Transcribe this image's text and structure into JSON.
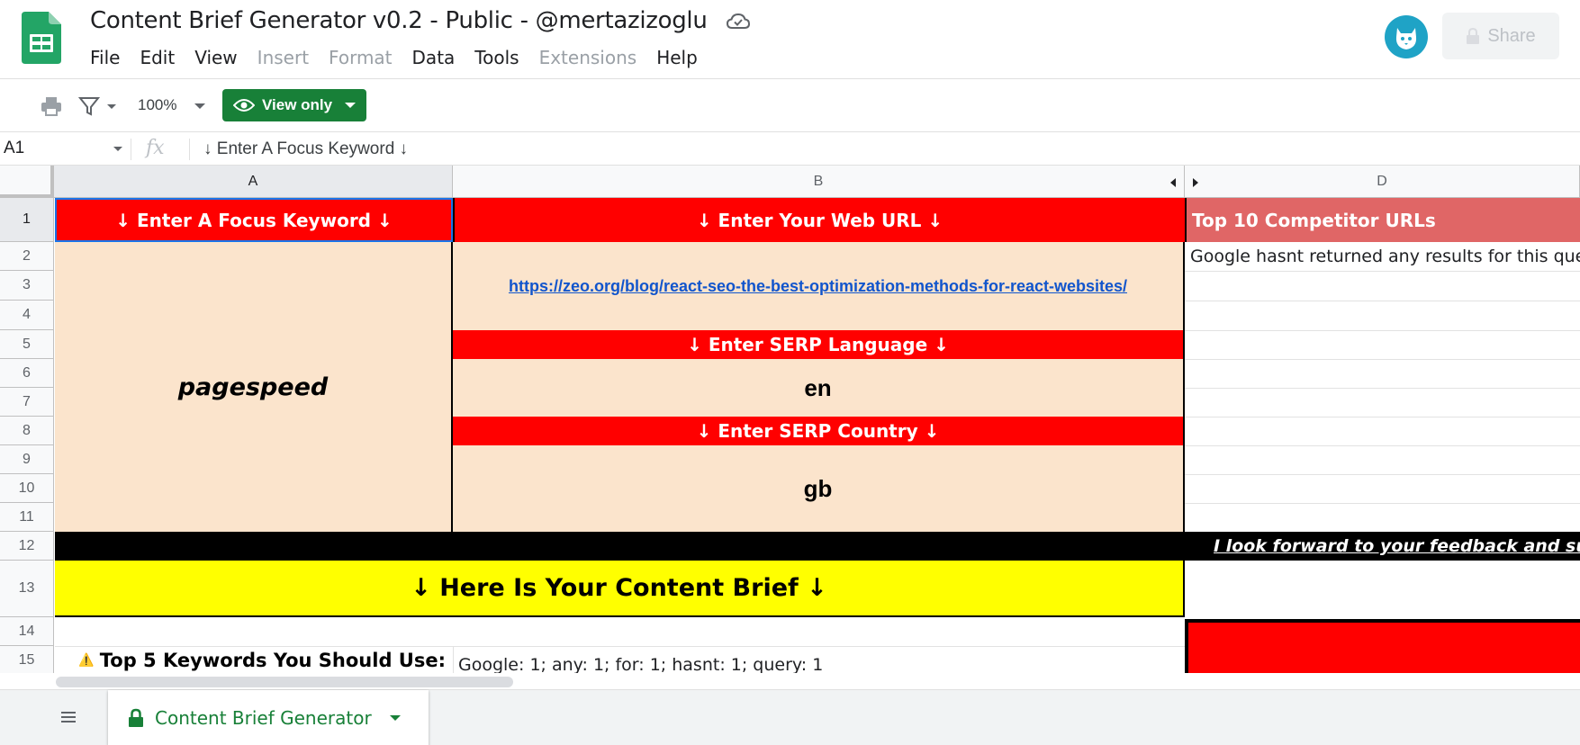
{
  "app": {
    "title": "Content Brief Generator v0.2 - Public - @mertazizoglu",
    "menu": [
      {
        "label": "File",
        "disabled": false
      },
      {
        "label": "Edit",
        "disabled": false
      },
      {
        "label": "View",
        "disabled": false
      },
      {
        "label": "Insert",
        "disabled": true
      },
      {
        "label": "Format",
        "disabled": true
      },
      {
        "label": "Data",
        "disabled": false
      },
      {
        "label": "Tools",
        "disabled": false
      },
      {
        "label": "Extensions",
        "disabled": true
      },
      {
        "label": "Help",
        "disabled": false
      }
    ],
    "share_label": "Share"
  },
  "toolbar": {
    "zoom": "100%",
    "view_only_label": "View only"
  },
  "formula_bar": {
    "cell_ref": "A1",
    "fx": "fx",
    "formula": "↓ Enter A Focus Keyword ↓"
  },
  "grid": {
    "columns": [
      "A",
      "B",
      "D"
    ],
    "rows": [
      "1",
      "2",
      "3",
      "4",
      "5",
      "6",
      "7",
      "8",
      "9",
      "10",
      "11",
      "12",
      "13",
      "14",
      "15"
    ],
    "cells": {
      "a1": "↓ Enter A Focus Keyword ↓",
      "b1": "↓ Enter Your Web URL ↓",
      "d1": "Top 10 Competitor URLs",
      "d2": "Google hasnt returned any results for this query",
      "b3": "https://zeo.org/blog/react-seo-the-best-optimization-methods-for-react-websites/",
      "b5": "↓ Enter SERP Language ↓",
      "a_keyword": "pagespeed",
      "b6": "en",
      "b8": "↓ Enter SERP Country ↓",
      "b10": "gb",
      "row12": "I look forward to your feedback and support",
      "a13": "↓ Here Is Your Content Brief ↓",
      "a15_icon": "⚠️",
      "a15": "Top 5 Keywords You Should Use:",
      "b15": "Google: 1; any: 1; for: 1; hasnt: 1; query: 1"
    }
  },
  "sheet_tabs": [
    {
      "label": "Content Brief Generator",
      "locked": true,
      "active": true
    }
  ],
  "colors": {
    "red": "#ff0000",
    "peach": "#fbe4cc",
    "yellow": "#ffff00",
    "muted_red": "#e06666",
    "green": "#188038",
    "link": "#1155cc"
  },
  "icons": [
    "sheets-logo-icon",
    "cloud-saved-icon",
    "avatar-icon",
    "share-lock-icon",
    "print-icon",
    "filter-icon",
    "eye-icon",
    "list-sheets-icon",
    "lock-icon"
  ]
}
